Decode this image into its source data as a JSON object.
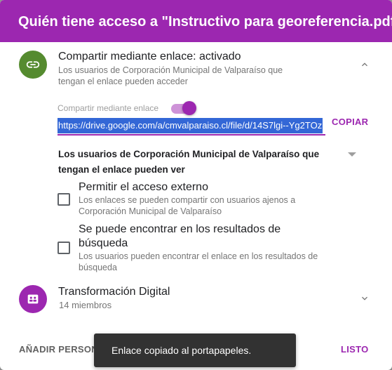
{
  "dialog": {
    "title": "Quién tiene acceso a \"Instructivo para georeferencia.pdf\""
  },
  "link_sharing": {
    "icon": "link-icon",
    "icon_color": "#558b2f",
    "title": "Compartir mediante enlace: activado",
    "subtitle": "Los usuarios de Corporación Municipal de Valparaíso que tengan el enlace pueden acceder",
    "toggle_label": "Compartir mediante enlace",
    "toggle_on": true,
    "link_url": "https://drive.google.com/a/cmvalparaiso.cl/file/d/14S7lgi--Yg2TOz",
    "copy_label": "COPIAR",
    "access_select": "Los usuarios de Corporación Municipal de Valparaíso que tengan el enlace pueden ver",
    "options": [
      {
        "title": "Permitir el acceso externo",
        "subtitle": "Los enlaces se pueden compartir con usuarios ajenos a Corporación Municipal de Valparaíso",
        "checked": false
      },
      {
        "title": "Se puede encontrar en los resultados de búsqueda",
        "subtitle": "Los usuarios pueden encontrar el enlace en los resultados de búsqueda",
        "checked": false
      }
    ]
  },
  "group": {
    "icon": "group-icon",
    "icon_color": "#9c27b0",
    "title": "Transformación Digital",
    "subtitle": "14 miembros"
  },
  "footer": {
    "add_label": "AÑADIR PERSONAS",
    "done_label": "LISTO"
  },
  "snackbar": {
    "message": "Enlace copiado al portapapeles."
  },
  "colors": {
    "accent": "#9c27b0",
    "selection": "#3367d6"
  }
}
